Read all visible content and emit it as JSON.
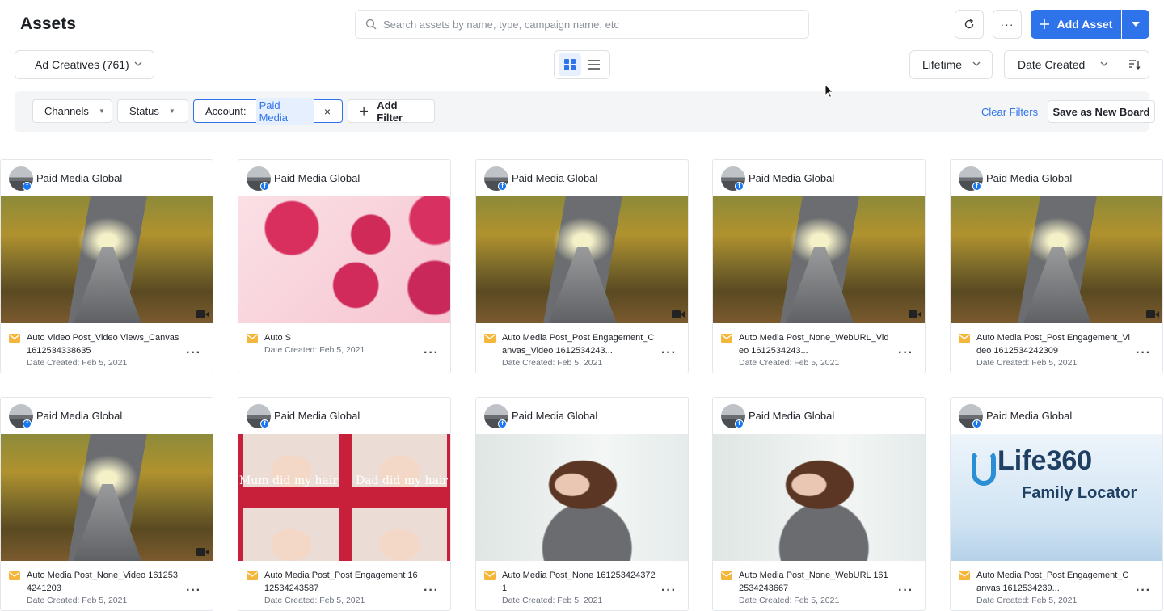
{
  "header": {
    "title": "Assets",
    "search_placeholder": "Search assets by name, type, campaign name, etc",
    "add_asset_label": "Add Asset"
  },
  "toolbar": {
    "asset_type_value": "Ad Creatives (761)",
    "period_value": "Lifetime",
    "sort_value": "Date Created"
  },
  "filters": {
    "channels_label": "Channels",
    "status_label": "Status",
    "account_label": "Account:",
    "account_value": "Paid Media",
    "add_filter_label": "Add Filter",
    "clear_filters_label": "Clear Filters",
    "save_board_label": "Save as New Board"
  },
  "colors": {
    "accent": "#2f73ea",
    "facebook": "#1877f2",
    "mail_icon": "#f5b73b"
  },
  "cards": [
    {
      "account": "Paid Media Global",
      "thumb": "road",
      "video": true,
      "name": "Auto Video Post_Video Views_Canvas 1612534338635",
      "date": "Date Created: Feb 5, 2021"
    },
    {
      "account": "Paid Media Global",
      "thumb": "roses",
      "video": false,
      "name": "Auto S",
      "date": "Date Created: Feb 5, 2021"
    },
    {
      "account": "Paid Media Global",
      "thumb": "road",
      "video": true,
      "name": "Auto Media Post_Post Engagement_Canvas_Video 1612534243...",
      "date": "Date Created: Feb 5, 2021"
    },
    {
      "account": "Paid Media Global",
      "thumb": "road",
      "video": true,
      "name": "Auto Media Post_None_WebURL_Video 1612534243...",
      "date": "Date Created: Feb 5, 2021"
    },
    {
      "account": "Paid Media Global",
      "thumb": "road",
      "video": true,
      "name": "Auto Media Post_Post Engagement_Video 1612534242309",
      "date": "Date Created: Feb 5, 2021"
    },
    {
      "account": "Paid Media Global",
      "thumb": "road",
      "video": true,
      "name": "Auto Media Post_None_Video 1612534241203",
      "date": "Date Created: Feb 5, 2021"
    },
    {
      "account": "Paid Media Global",
      "thumb": "babies",
      "video": false,
      "name": "Auto Media Post_Post Engagement 1612534243587",
      "date": "Date Created: Feb 5, 2021",
      "captions": [
        "Mum did my hair",
        "Dad did my hair"
      ]
    },
    {
      "account": "Paid Media Global",
      "thumb": "woman",
      "video": false,
      "name": "Auto Media Post_None 1612534243721",
      "date": "Date Created: Feb 5, 2021"
    },
    {
      "account": "Paid Media Global",
      "thumb": "woman",
      "video": false,
      "name": "Auto Media Post_None_WebURL 1612534243667",
      "date": "Date Created: Feb 5, 2021"
    },
    {
      "account": "Paid Media Global",
      "thumb": "life",
      "video": false,
      "name": "Auto Media Post_Post Engagement_Canvas 1612534239...",
      "date": "Date Created: Feb 5, 2021",
      "captions": [
        "Life360",
        "Family Locator"
      ]
    }
  ]
}
